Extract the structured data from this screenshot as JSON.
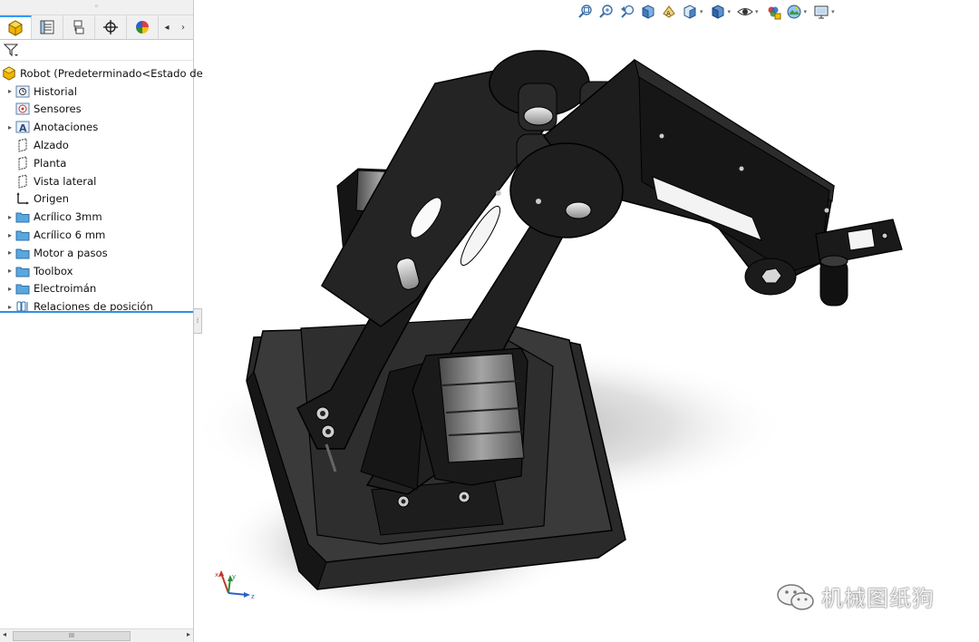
{
  "panel": {
    "tabs": [
      {
        "name": "feature-manager-tab",
        "icon": "assembly-cube-icon",
        "active": true
      },
      {
        "name": "property-manager-tab",
        "icon": "property-list-icon",
        "active": false
      },
      {
        "name": "configuration-manager-tab",
        "icon": "configuration-icon",
        "active": false
      },
      {
        "name": "dimxpert-tab",
        "icon": "crosshair-icon",
        "active": false
      },
      {
        "name": "display-manager-tab",
        "icon": "color-wheel-icon",
        "active": false
      }
    ],
    "tree": {
      "root_label": "Robot  (Predeterminado<Estado de",
      "items": [
        {
          "label": "Historial",
          "icon": "history-folder-icon",
          "expandable": true
        },
        {
          "label": "Sensores",
          "icon": "sensor-icon",
          "expandable": false
        },
        {
          "label": "Anotaciones",
          "icon": "annotation-icon",
          "expandable": true
        },
        {
          "label": "Alzado",
          "icon": "plane-icon",
          "expandable": false
        },
        {
          "label": "Planta",
          "icon": "plane-icon",
          "expandable": false
        },
        {
          "label": "Vista lateral",
          "icon": "plane-icon",
          "expandable": false
        },
        {
          "label": "Origen",
          "icon": "origin-icon",
          "expandable": false
        },
        {
          "label": "Acrílico 3mm",
          "icon": "folder-icon",
          "expandable": true
        },
        {
          "label": "Acrílico 6 mm",
          "icon": "folder-icon",
          "expandable": true
        },
        {
          "label": "Motor a pasos",
          "icon": "folder-icon",
          "expandable": true
        },
        {
          "label": "Toolbox",
          "icon": "folder-icon",
          "expandable": true
        },
        {
          "label": "Electroimán",
          "icon": "folder-icon",
          "expandable": true
        },
        {
          "label": "Relaciones de posición",
          "icon": "mates-icon",
          "expandable": true
        }
      ]
    },
    "scroll_thumb_label": "III"
  },
  "hud": {
    "buttons": [
      "zoom-to-fit-icon",
      "zoom-to-area-icon",
      "previous-view-icon",
      "section-view-icon",
      "dynamic-annotation-icon",
      "view-orientation-icon",
      "display-style-icon",
      "hide-show-items-icon",
      "edit-appearance-icon",
      "apply-scene-icon",
      "view-settings-icon"
    ]
  },
  "viewport": {
    "triad_axes": [
      "x",
      "y",
      "z"
    ],
    "model_name": "robot-arm-model"
  },
  "watermark": {
    "text": "机械图纸狗"
  },
  "colors": {
    "accent": "#2f8fe3",
    "folder": "#5aa7e0",
    "model_body": "#1b1b1b",
    "model_edge": "#000000",
    "motor_grey": "#8e8e8e"
  }
}
